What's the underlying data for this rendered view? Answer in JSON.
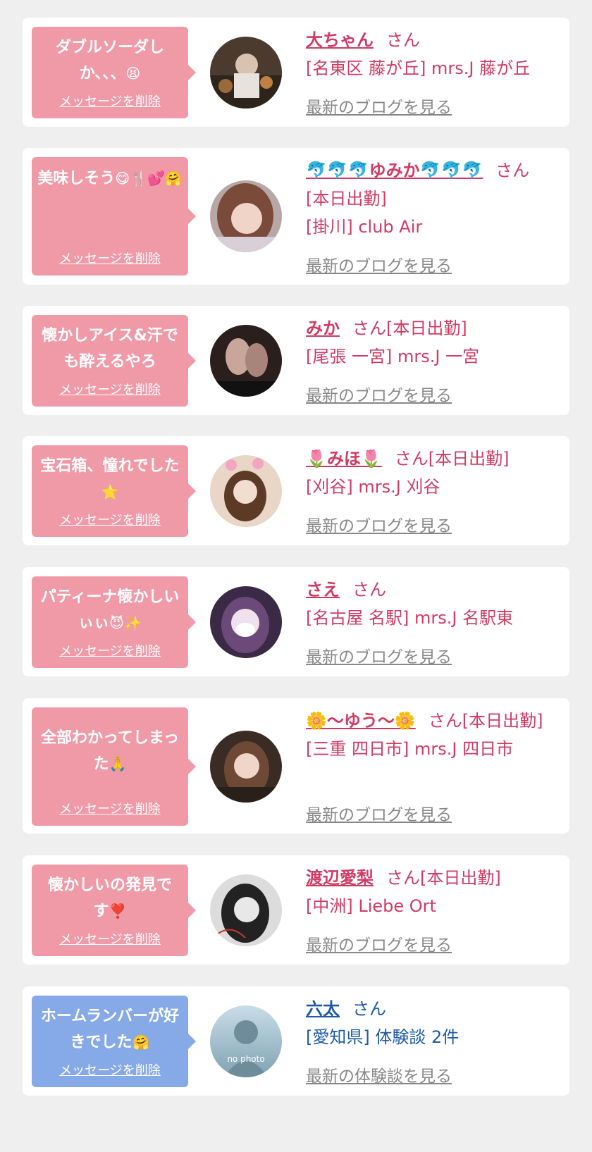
{
  "colors": {
    "pink_bubble": "#f09aa8",
    "blue_bubble": "#86a9e8",
    "pink_text": "#d23a63",
    "blue_text": "#1e5aa8",
    "link_gray": "#888888"
  },
  "delete_label": "メッセージを削除",
  "cards": [
    {
      "message": "ダブルソーダしか、、、",
      "message_emoji": "😫",
      "name": "大ちゃん",
      "honorific": "さん",
      "lines": [
        "[名東区 藤が丘] mrs.J 藤が丘"
      ],
      "link": "最新のブログを見る",
      "theme": "pink"
    },
    {
      "message": "美味しそう",
      "message_emoji": "😋🍴💕🤗",
      "name": "🐬🐬🐬ゆみか🐬🐬🐬",
      "honorific": "さん",
      "lines": [
        "[本日出勤]",
        "[掛川] club Air"
      ],
      "link": "最新のブログを見る",
      "theme": "pink"
    },
    {
      "message": "懐かしアイス&汗でも酔えるやろ",
      "message_emoji": "",
      "name": "みか",
      "honorific": "さん[本日出勤]",
      "lines": [
        "[尾張 一宮] mrs.J 一宮"
      ],
      "link": "最新のブログを見る",
      "theme": "pink"
    },
    {
      "message": "宝石箱、憧れでした",
      "message_emoji": "⭐",
      "name": "🌷みほ🌷",
      "honorific": "さん[本日出勤]",
      "lines": [
        "[刈谷] mrs.J 刈谷"
      ],
      "link": "最新のブログを見る",
      "theme": "pink"
    },
    {
      "message": "パティーナ懐かしいぃぃ",
      "message_emoji": "😈✨",
      "name": "さえ",
      "honorific": "さん",
      "lines": [
        "[名古屋 名駅] mrs.J 名駅東"
      ],
      "link": "最新のブログを見る",
      "theme": "pink"
    },
    {
      "message": "全部わかってしまった",
      "message_emoji": "🙏",
      "name": "🌼〜ゆう〜🌼",
      "honorific": "さん[本日出勤]",
      "lines": [
        "[三重 四日市] mrs.J 四日市"
      ],
      "link": "最新のブログを見る",
      "theme": "pink"
    },
    {
      "message": "懐かしいの発見です",
      "message_emoji": "❣️",
      "name": "渡辺愛梨",
      "honorific": "さん[本日出勤]",
      "lines": [
        "[中洲] Liebe Ort"
      ],
      "link": "最新のブログを見る",
      "theme": "pink"
    },
    {
      "message": "ホームランバーが好きでした",
      "message_emoji": "🤗",
      "name": "六太",
      "honorific": "さん",
      "lines": [
        "[愛知県] 体験談 2件"
      ],
      "link": "最新の体験談を見る",
      "theme": "blue",
      "avatar_text": "no photo"
    }
  ]
}
